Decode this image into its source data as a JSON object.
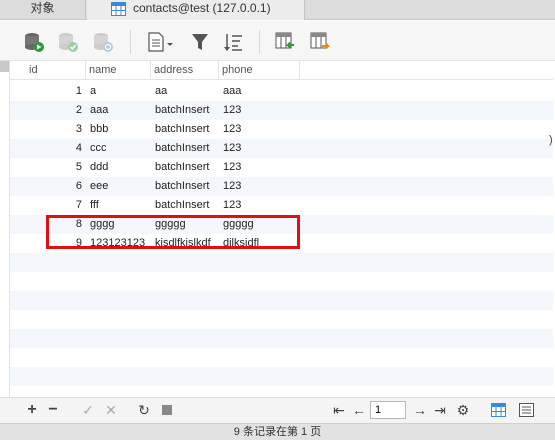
{
  "tabs": {
    "objects": "对象",
    "table": "contacts@test (127.0.0.1)"
  },
  "columns": [
    "id",
    "name",
    "address",
    "phone"
  ],
  "rows": [
    {
      "id": "1",
      "name": "a",
      "address": "aa",
      "phone": "aaa"
    },
    {
      "id": "2",
      "name": "aaa",
      "address": "batchInsert",
      "phone": "123"
    },
    {
      "id": "3",
      "name": "bbb",
      "address": "batchInsert",
      "phone": "123"
    },
    {
      "id": "4",
      "name": "ccc",
      "address": "batchInsert",
      "phone": "123"
    },
    {
      "id": "5",
      "name": "ddd",
      "address": "batchInsert",
      "phone": "123"
    },
    {
      "id": "6",
      "name": "eee",
      "address": "batchInsert",
      "phone": "123"
    },
    {
      "id": "7",
      "name": "fff",
      "address": "batchInsert",
      "phone": "123"
    },
    {
      "id": "8",
      "name": "gggg",
      "address": "ggggg",
      "phone": "ggggg"
    },
    {
      "id": "9",
      "name": "123123123",
      "address": "kjsdlfkjslkdf",
      "phone": "djlksjdfl"
    }
  ],
  "pagination": {
    "page": "1"
  },
  "status": "9 条记录在第 1 页",
  "side_text": ")",
  "colors": {
    "highlight": "#e01010",
    "accent": "#3a8ad6",
    "row_alt": "#f3f7fb"
  }
}
